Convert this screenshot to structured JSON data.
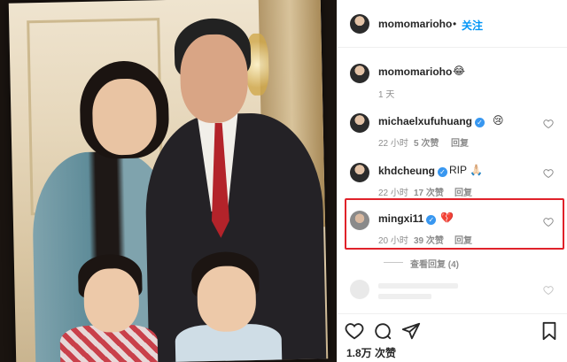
{
  "post": {
    "author": "momomarioho",
    "separator": "•",
    "follow_label": "关注"
  },
  "caption": {
    "username": "momomarioho",
    "text": "😂",
    "time": "1 天"
  },
  "comments": [
    {
      "username": "michaelxufuhuang",
      "verified": true,
      "text": "😢",
      "time": "22 小时",
      "likes": "5 次赞",
      "reply_label": "回复"
    },
    {
      "username": "khdcheung",
      "verified": true,
      "text": "RIP 🙏🏻",
      "time": "22 小时",
      "likes": "17 次赞",
      "reply_label": "回复"
    },
    {
      "username": "mingxi11",
      "verified": true,
      "text": "💔",
      "time": "20 小时",
      "likes": "39 次赞",
      "reply_label": "回复"
    }
  ],
  "view_replies": "查看回复 (4)",
  "icons": {
    "verified": "verified-badge-icon",
    "like_comment": "heart-outline-icon",
    "like": "heart-icon",
    "comment": "comment-bubble-icon",
    "share": "paper-plane-icon",
    "save": "bookmark-icon"
  },
  "like_count": "1.8万 次赞",
  "colors": {
    "follow": "#0095f6",
    "verified": "#3897f0",
    "highlight": "#e0222a",
    "secondary_text": "#8e8e8e"
  }
}
